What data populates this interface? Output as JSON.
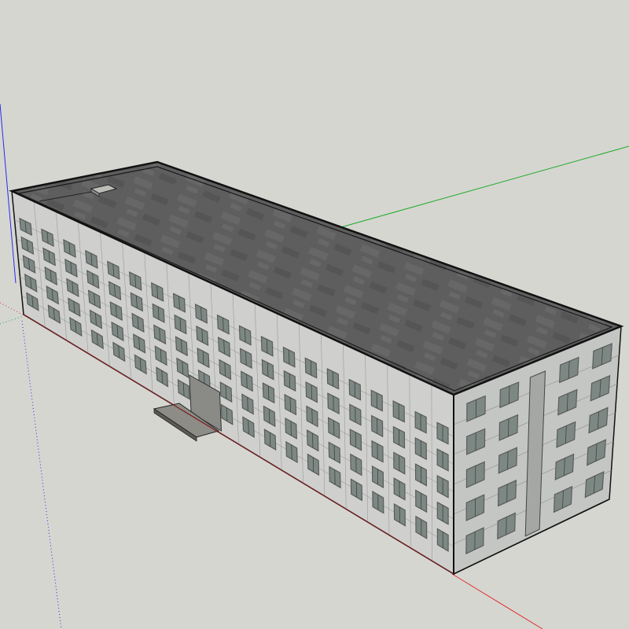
{
  "scene": {
    "subject": "building-3d-model",
    "colors": {
      "background": "#d6d6d1",
      "axis_red": "#e0302a",
      "axis_green": "#1faa2a",
      "axis_blue": "#2a2aee",
      "roof": "#5e5e5e",
      "wall": "#cfd0cd",
      "window_frame": "#5a5c5a",
      "window_glass": "#7d8884",
      "outline": "#111111"
    },
    "facade": {
      "front_floors": 5,
      "front_window_columns": 20,
      "side_window_columns": 4
    }
  }
}
